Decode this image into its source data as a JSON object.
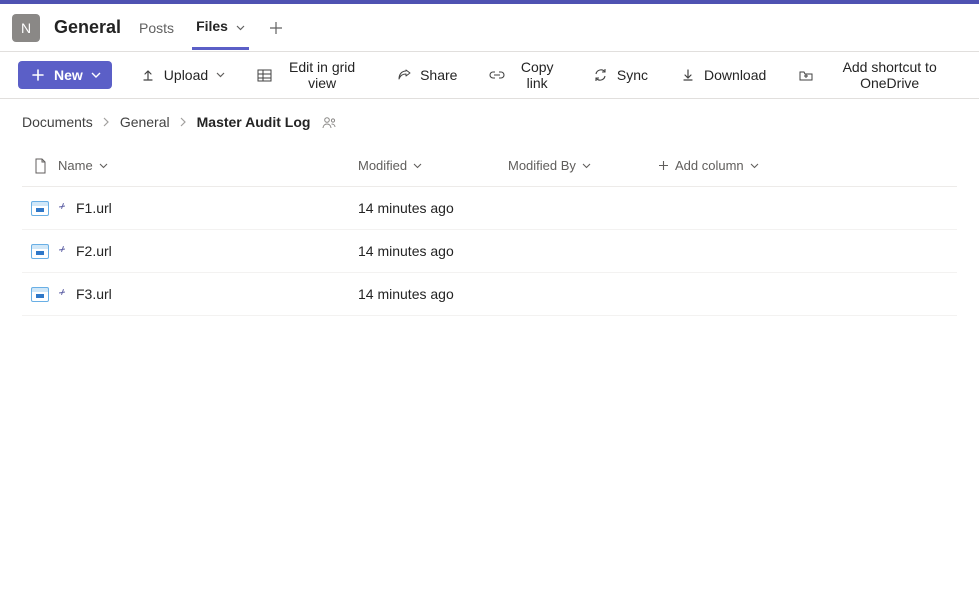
{
  "header": {
    "team_avatar_letter": "N",
    "channel_name": "General",
    "tabs": [
      {
        "label": "Posts",
        "active": false
      },
      {
        "label": "Files",
        "active": true,
        "has_dropdown": true
      }
    ]
  },
  "toolbar": {
    "new_label": "New",
    "upload_label": "Upload",
    "edit_grid_label": "Edit in grid view",
    "share_label": "Share",
    "copy_link_label": "Copy link",
    "sync_label": "Sync",
    "download_label": "Download",
    "add_shortcut_label": "Add shortcut to OneDrive"
  },
  "breadcrumb": {
    "items": [
      "Documents",
      "General"
    ],
    "current": "Master Audit Log"
  },
  "columns": {
    "name": "Name",
    "modified": "Modified",
    "modified_by": "Modified By",
    "add_column": "Add column"
  },
  "files": [
    {
      "name": "F1.url",
      "modified": "14 minutes ago",
      "modified_by": ""
    },
    {
      "name": "F2.url",
      "modified": "14 minutes ago",
      "modified_by": ""
    },
    {
      "name": "F3.url",
      "modified": "14 minutes ago",
      "modified_by": ""
    }
  ]
}
